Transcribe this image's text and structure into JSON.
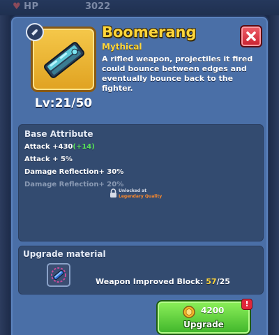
{
  "background": {
    "stat_label": "HP",
    "stat_value": "3022"
  },
  "item": {
    "name": "Boomerang",
    "rarity": "Mythical",
    "description": "A rifled weapon, projectiles it fired could bounce between edges and eventually bounce back to the fighter.",
    "level": "Lv:21/50",
    "icon": "boomerang-weapon-icon",
    "rarity_color": "#ffd63a"
  },
  "attributes": {
    "title": "Base Attribute",
    "attack_base": "Attack +430",
    "attack_bonus": "(+14)",
    "attack_percent": "Attack + 5%",
    "reflection": "Damage Reflection+ 30%",
    "reflection_locked": "Damage Reflection+ 20%",
    "locked_label": "Unlocked at",
    "locked_quality": "Legendary Quality"
  },
  "material": {
    "title": "Upgrade material",
    "name": "Weapon Improved Block:",
    "have": "57",
    "need": "/25",
    "icon": "weapon-block-icon"
  },
  "upgrade": {
    "cost": "4200",
    "label": "Upgrade",
    "alert": "!",
    "coin_icon": "gold-coin-icon"
  },
  "colors": {
    "panel": "#4a6fa7",
    "accent_green": "#58e05a",
    "legendary_orange": "#ff8a2a",
    "close_red": "#d8303c"
  }
}
